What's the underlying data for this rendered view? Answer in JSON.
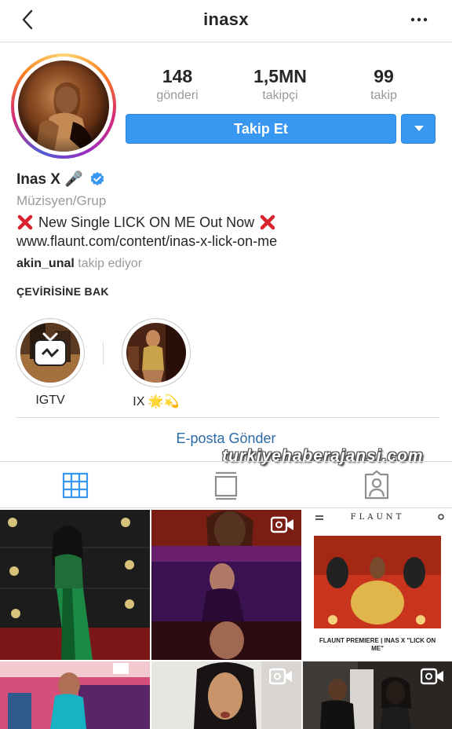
{
  "header": {
    "username": "inasx",
    "back_icon": "chevron-left-icon",
    "more_icon": "more-horizontal-icon"
  },
  "profile": {
    "stats": [
      {
        "value": "148",
        "label": "gönderi"
      },
      {
        "value": "1,5MN",
        "label": "takipçi"
      },
      {
        "value": "99",
        "label": "takip"
      }
    ],
    "follow_label": "Takip Et",
    "display_name": "Inas X 🎤",
    "verified": true,
    "category": "Müzisyen/Grup",
    "bio_text": "New Single LICK ON ME Out Now",
    "website": "www.flaunt.com/content/inas-x-lick-on-me",
    "followed_by_user": "akin_unal",
    "followed_by_text": "takip ediyor",
    "translate_label": "ÇEVİRİSİNE BAK"
  },
  "highlights": [
    {
      "label": "IGTV"
    },
    {
      "label": "IX 🌟💫"
    }
  ],
  "email_button": "E-posta Gönder",
  "watermark": "turkiyehaberajansi.com",
  "tabs": [
    {
      "name": "grid",
      "icon": "grid-icon",
      "active": true
    },
    {
      "name": "feed",
      "icon": "feed-icon",
      "active": false
    },
    {
      "name": "tagged",
      "icon": "tagged-person-icon",
      "active": false
    }
  ],
  "posts": [
    {
      "type": "photo"
    },
    {
      "type": "video"
    },
    {
      "type": "photo",
      "brand": "FLAUNT",
      "caption": "FLAUNT PREMIERE | INAS X \"LICK ON ME\""
    },
    {
      "type": "photo"
    },
    {
      "type": "video"
    },
    {
      "type": "video"
    }
  ],
  "colors": {
    "accent": "#3897f0",
    "link_blue": "#2c6aa8",
    "muted": "#999999",
    "divider": "#dbdbdb",
    "verified": "#3897f0",
    "red_x": "#d9232e"
  }
}
